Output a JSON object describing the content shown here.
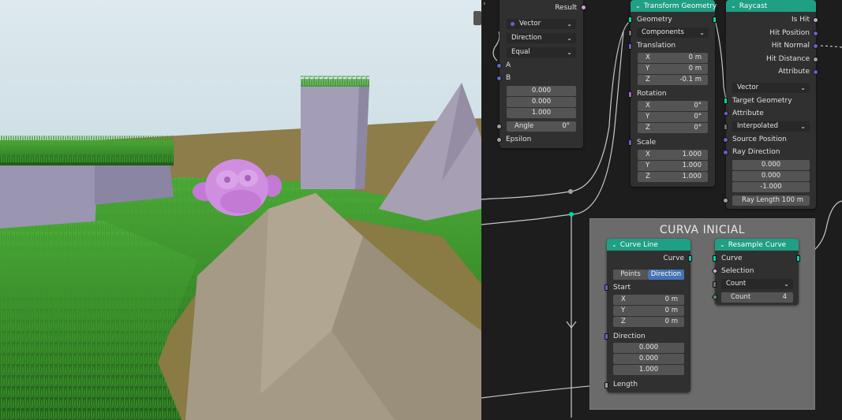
{
  "colors": {
    "node_header": "#1f9f83",
    "frame_bg": "#6b6b6b",
    "editor_bg": "#1d1d1d",
    "active_toggle": "#4772b3",
    "geometry_socket": "#00d6a3",
    "vector_socket": "#6363c7",
    "float_socket": "#a1a1a1"
  },
  "compare_node": {
    "result_label": "Result",
    "type_value": "Vector",
    "mode_value": "Direction",
    "operation_value": "Equal",
    "a_label": "A",
    "b_label": "B",
    "b_values": [
      "0.000",
      "0.000",
      "1.000"
    ],
    "angle_label": "Angle",
    "angle_value": "0°",
    "epsilon_label": "Epsilon"
  },
  "transform_node": {
    "title": "Transform Geometry",
    "geometry_label": "Geometry",
    "mode_value": "Components",
    "translation_label": "Translation",
    "translation": [
      {
        "axis": "X",
        "value": "0 m"
      },
      {
        "axis": "Y",
        "value": "0 m"
      },
      {
        "axis": "Z",
        "value": "-0.1 m"
      }
    ],
    "rotation_label": "Rotation",
    "rotation": [
      {
        "axis": "X",
        "value": "0°"
      },
      {
        "axis": "Y",
        "value": "0°"
      },
      {
        "axis": "Z",
        "value": "0°"
      }
    ],
    "scale_label": "Scale",
    "scale": [
      {
        "axis": "X",
        "value": "1.000"
      },
      {
        "axis": "Y",
        "value": "1.000"
      },
      {
        "axis": "Z",
        "value": "1.000"
      }
    ]
  },
  "raycast_node": {
    "title": "Raycast",
    "is_hit": "Is Hit",
    "hit_position": "Hit Position",
    "hit_normal": "Hit Normal",
    "hit_distance": "Hit Distance",
    "attribute_out": "Attribute",
    "data_type_value": "Vector",
    "target_geometry": "Target Geometry",
    "attribute_in": "Attribute",
    "mapping_value": "Interpolated",
    "source_position": "Source Position",
    "ray_direction": "Ray Direction",
    "ray_direction_values": [
      "0.000",
      "0.000",
      "-1.000"
    ],
    "ray_length_label": "Ray Length",
    "ray_length_value": "100 m"
  },
  "frame": {
    "title": "CURVA INICIAL"
  },
  "curve_line_node": {
    "title": "Curve Line",
    "curve_out": "Curve",
    "mode_points": "Points",
    "mode_direction": "Direction",
    "start_label": "Start",
    "start": [
      {
        "axis": "X",
        "value": "0 m"
      },
      {
        "axis": "Y",
        "value": "0 m"
      },
      {
        "axis": "Z",
        "value": "0 m"
      }
    ],
    "direction_label": "Direction",
    "direction_values": [
      "0.000",
      "0.000",
      "1.000"
    ],
    "length_label": "Length"
  },
  "resample_node": {
    "title": "Resample Curve",
    "curve_label": "Curve",
    "selection_label": "Selection",
    "mode_value": "Count",
    "count_label": "Count",
    "count_value": "4"
  }
}
